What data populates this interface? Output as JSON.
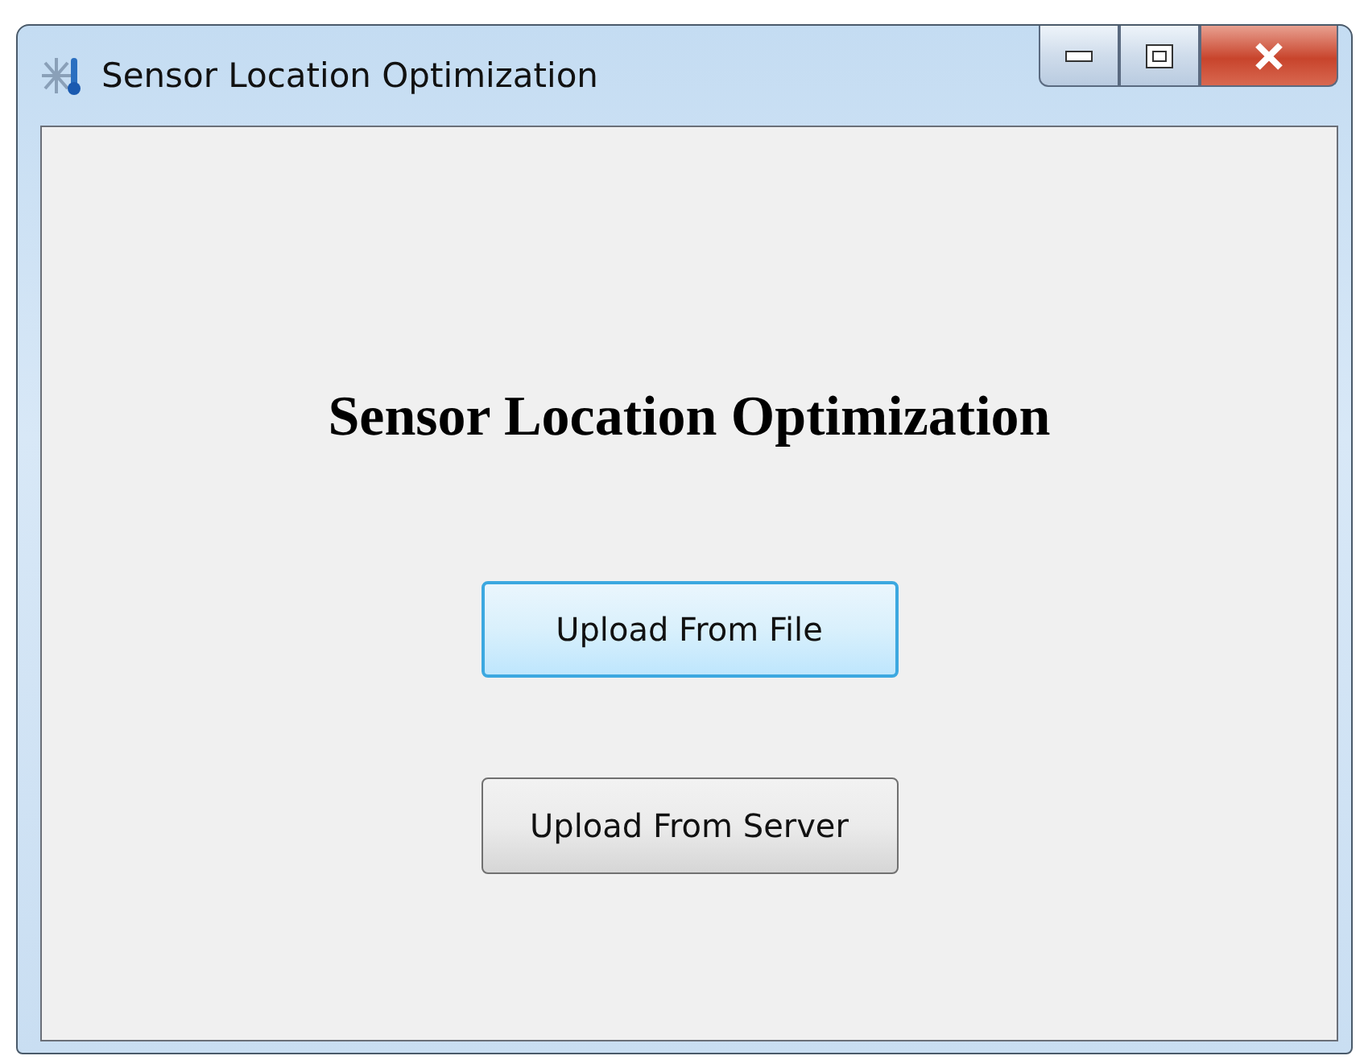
{
  "window": {
    "title": "Sensor Location Optimization"
  },
  "heading": "Sensor Location Optimization",
  "buttons": [
    {
      "label": "Upload From File",
      "focused": true
    },
    {
      "label": "Upload From Server",
      "focused": false
    }
  ]
}
